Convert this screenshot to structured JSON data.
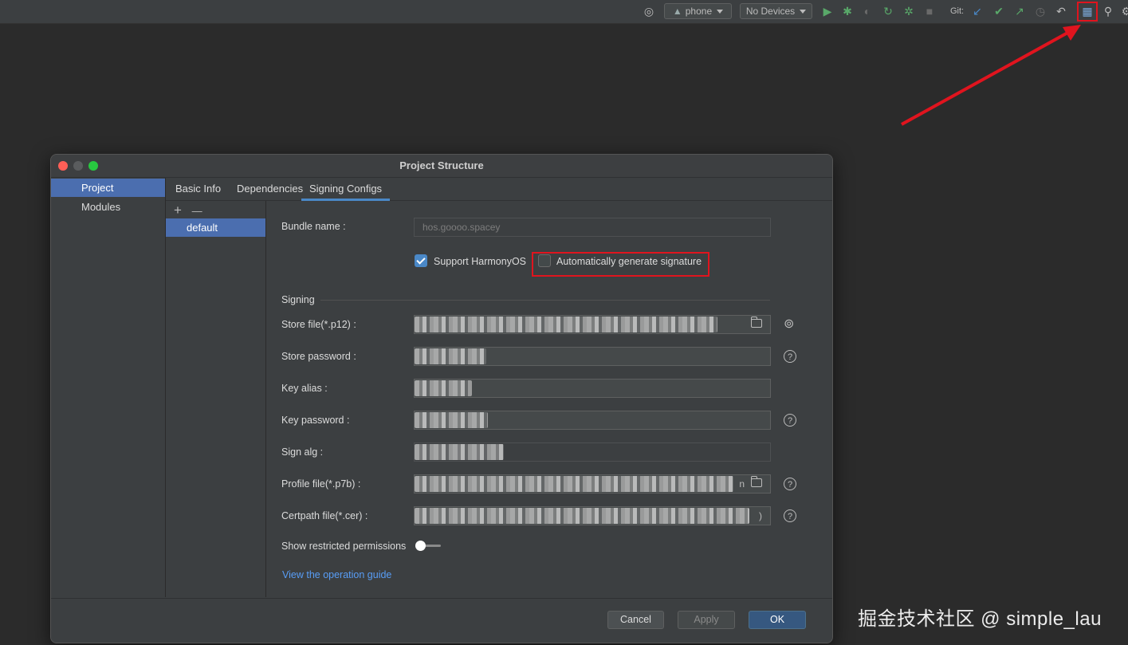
{
  "toolbar": {
    "device_config": "phone",
    "devices": "No Devices",
    "git_label": "Git:"
  },
  "dialog": {
    "title": "Project Structure",
    "nav": [
      "Project",
      "Modules"
    ],
    "tabs": [
      "Basic Info",
      "Dependencies",
      "Signing Configs"
    ],
    "config_list": {
      "add": "+",
      "remove": "—",
      "items": [
        "default"
      ]
    },
    "form": {
      "bundle_name_label": "Bundle name :",
      "bundle_name_value": "hos.goooo.spacey",
      "support_harmonyos_label": "Support HarmonyOS",
      "support_harmonyos_checked": true,
      "auto_sign_label": "Automatically generate signature",
      "auto_sign_checked": false,
      "signing_section": "Signing",
      "store_file_label": "Store file(*.p12) :",
      "store_password_label": "Store password :",
      "key_alias_label": "Key alias :",
      "key_password_label": "Key password :",
      "sign_alg_label": "Sign alg :",
      "profile_file_label": "Profile file(*.p7b) :",
      "profile_file_suffix": "n",
      "certpath_file_label": "Certpath file(*.cer) :",
      "certpath_file_suffix": ")",
      "show_restricted_label": "Show restricted permissions",
      "show_restricted_on": false,
      "guide_link": "View the operation guide",
      "help_glyph": "?"
    },
    "buttons": {
      "cancel": "Cancel",
      "apply": "Apply",
      "ok": "OK"
    }
  },
  "watermark": "掘金技术社区 @ simple_lau",
  "colors": {
    "accent": "#4a88c7",
    "selection": "#4b6eaf",
    "annotation_red": "#e0141e",
    "link": "#589df6"
  }
}
